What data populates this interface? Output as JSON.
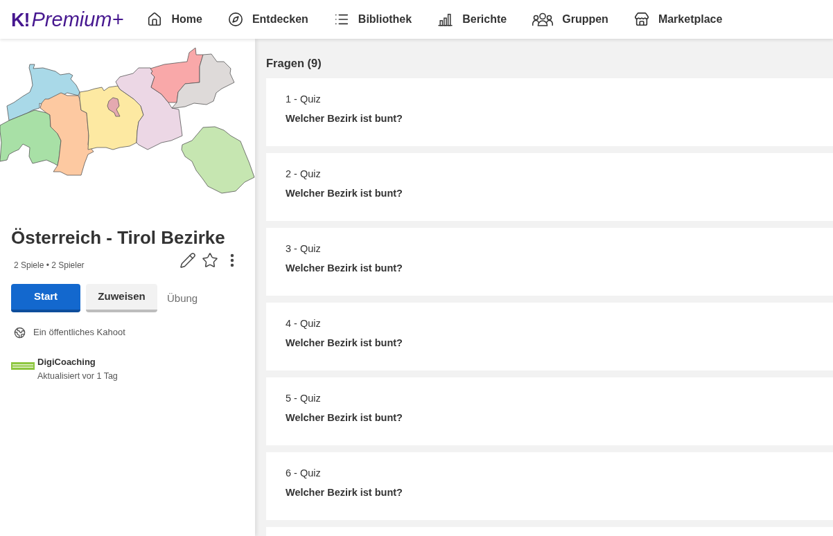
{
  "header": {
    "logo": {
      "mark": "K!",
      "text": "Premium+"
    },
    "nav": [
      {
        "label": "Home"
      },
      {
        "label": "Entdecken"
      },
      {
        "label": "Bibliothek"
      },
      {
        "label": "Berichte"
      },
      {
        "label": "Gruppen"
      },
      {
        "label": "Marketplace"
      }
    ]
  },
  "kahoot": {
    "title": "Österreich - Tirol Bezirke",
    "stats": "2 Spiele • 2 Spieler",
    "buttons": [
      {
        "label": "Start",
        "kind": "primary"
      },
      {
        "label": "Zuweisen",
        "kind": "secondary"
      },
      {
        "label": "Übung",
        "kind": "link"
      }
    ],
    "visibility": "Ein öffentliches Kahoot",
    "creator": {
      "name": "DigiCoaching",
      "updated": "Aktualisiert vor 1 Tag"
    }
  },
  "questions": {
    "heading": "Fragen (9)",
    "items": [
      {
        "type": "1 - Quiz",
        "question": "Welcher Bezirk ist bunt?"
      },
      {
        "type": "2 - Quiz",
        "question": "Welcher Bezirk ist bunt?"
      },
      {
        "type": "3 - Quiz",
        "question": "Welcher Bezirk ist bunt?"
      },
      {
        "type": "4 - Quiz",
        "question": "Welcher Bezirk ist bunt?"
      },
      {
        "type": "5 - Quiz",
        "question": "Welcher Bezirk ist bunt?"
      },
      {
        "type": "6 - Quiz",
        "question": "Welcher Bezirk ist bunt?"
      }
    ],
    "more_below": true
  }
}
